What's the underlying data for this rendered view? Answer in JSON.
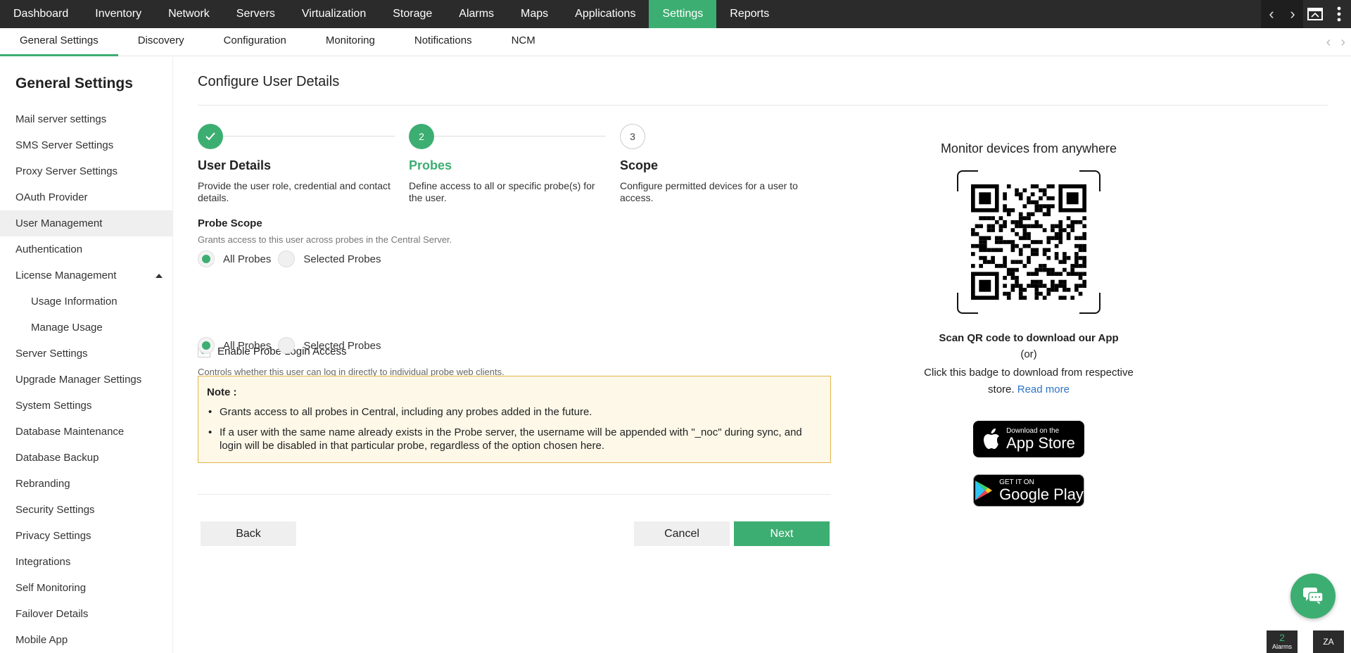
{
  "top_nav": {
    "items": [
      "Dashboard",
      "Inventory",
      "Network",
      "Servers",
      "Virtualization",
      "Storage",
      "Alarms",
      "Maps",
      "Applications",
      "Settings",
      "Reports"
    ],
    "active": "Settings"
  },
  "sub_nav": {
    "items": [
      "General Settings",
      "Discovery",
      "Configuration",
      "Monitoring",
      "Notifications",
      "NCM"
    ],
    "active": "General Settings"
  },
  "sidebar": {
    "title": "General Settings",
    "items": [
      {
        "label": "Mail server settings"
      },
      {
        "label": "SMS Server Settings"
      },
      {
        "label": "Proxy Server Settings"
      },
      {
        "label": "OAuth Provider"
      },
      {
        "label": "User Management",
        "active": true
      },
      {
        "label": "Authentication"
      },
      {
        "label": "License Management",
        "expanded": true
      },
      {
        "label": "Usage Information",
        "sub": true
      },
      {
        "label": "Manage Usage",
        "sub": true
      },
      {
        "label": "Server Settings"
      },
      {
        "label": "Upgrade Manager Settings"
      },
      {
        "label": "System Settings"
      },
      {
        "label": "Database Maintenance"
      },
      {
        "label": "Database Backup"
      },
      {
        "label": "Rebranding"
      },
      {
        "label": "Security Settings"
      },
      {
        "label": "Privacy Settings"
      },
      {
        "label": "Integrations"
      },
      {
        "label": "Self Monitoring"
      },
      {
        "label": "Failover Details"
      },
      {
        "label": "Mobile App"
      }
    ]
  },
  "main": {
    "title": "Configure User Details",
    "steps": [
      {
        "number": "",
        "status": "done",
        "title": "User Details",
        "desc": "Provide the user role, credential and contact details."
      },
      {
        "number": "2",
        "status": "current",
        "title": "Probes",
        "desc": "Define access to all or specific probe(s) for the user."
      },
      {
        "number": "3",
        "status": "todo",
        "title": "Scope",
        "desc": "Configure permitted devices for a user to access."
      }
    ],
    "probe_scope": {
      "title": "Probe Scope",
      "desc": "Grants access to this user across probes in the Central Server.",
      "option_all": "All Probes",
      "option_selected": "Selected Probes",
      "selected": "All Probes"
    },
    "probe_login": {
      "label": "Enable Probe Login Access",
      "checked": true,
      "desc": "Controls whether this user can log in directly to individual probe web clients.",
      "option_all": "All Probes",
      "option_selected": "Selected Probes",
      "selected": "All Probes"
    },
    "note": {
      "title": "Note :",
      "items": [
        "Grants access to all probes in Central, including any probes added in the future.",
        "If a user with the same name already exists in the Probe server, the username will be appended with \"_noc\" during sync, and login will be disabled in that particular probe, regardless of the option chosen here."
      ]
    },
    "buttons": {
      "back": "Back",
      "cancel": "Cancel",
      "next": "Next"
    }
  },
  "app_panel": {
    "title": "Monitor devices from anywhere",
    "scan_text": "Scan QR code to download our App",
    "or_text": "(or)",
    "click_text": "Click this badge to download from respective store.",
    "read_more": "Read more",
    "apple_small": "Download on the",
    "apple_big": "App Store",
    "google_small": "GET IT ON",
    "google_big": "Google Play"
  },
  "footer_badges": {
    "alarm_count": "2",
    "alarm_label": "Alarms",
    "other_label": "ZA"
  },
  "colors": {
    "accent": "#3dae72",
    "topbar": "#2b2b2b",
    "note_bg": "#fdf8e8",
    "note_border": "#e2b64b",
    "link": "#2b74c9"
  }
}
